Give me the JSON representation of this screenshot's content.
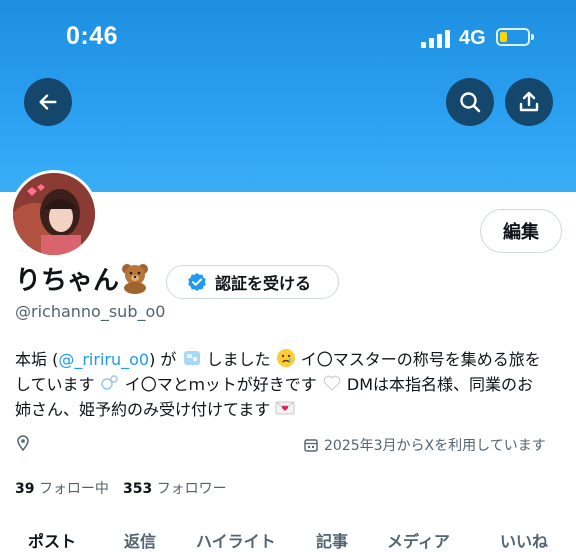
{
  "status_bar": {
    "time": "0:46",
    "network": "4G"
  },
  "colors": {
    "banner": "#2a9ff0",
    "accent": "#1d9bf0",
    "header_button": "#14476b",
    "battery_fill": "#ffd60a"
  },
  "header": {
    "back_icon": "arrow-left-icon",
    "search_icon": "search-icon",
    "share_icon": "share-icon"
  },
  "profile": {
    "edit_label": "編集",
    "display_name": "りちゃん",
    "verify_label": "認証を受ける",
    "handle": "@richanno_sub_o0",
    "bio": {
      "p1": "本垢 (",
      "mention": "@_ririru_o0",
      "p2": ") が ",
      "p3": " しました ",
      "p4": " イ〇マスターの称号を集める旅を",
      "line2a": "しています ",
      "line2b": " イ〇マとｍットが好きです ",
      "line2c": " DMは本指名様、同業のお",
      "line3": "姉さん、姫予約のみ受け付けてます "
    },
    "location_icon": "location-pin-icon",
    "joined_icon": "calendar-icon",
    "joined": "2025年3月からXを利用しています",
    "following_count": "39",
    "following_label": "フォロー中",
    "followers_count": "353",
    "followers_label": "フォロワー"
  },
  "tabs": [
    {
      "label": "ポスト"
    },
    {
      "label": "返信"
    },
    {
      "label": "ハイライト"
    },
    {
      "label": "記事"
    },
    {
      "label": "メディア"
    },
    {
      "label": "いいね"
    }
  ]
}
